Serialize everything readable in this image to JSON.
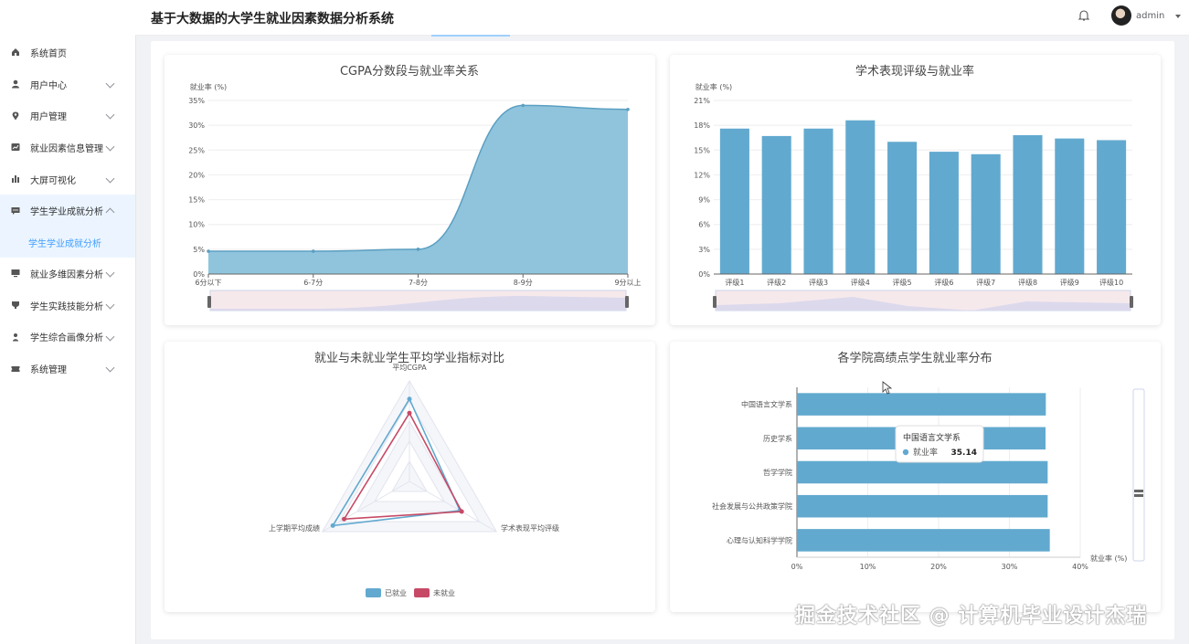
{
  "app": {
    "title": "基于大数据的大学生就业因素数据分析系统",
    "user": "admin"
  },
  "sidebar": {
    "items": [
      {
        "label": "系统首页",
        "icon": "home-icon",
        "arrow": false
      },
      {
        "label": "用户中心",
        "icon": "user-icon",
        "arrow": true
      },
      {
        "label": "用户管理",
        "icon": "location-icon",
        "arrow": true
      },
      {
        "label": "就业因素信息管理",
        "icon": "chart-icon",
        "arrow": true
      },
      {
        "label": "大屏可视化",
        "icon": "bar-icon",
        "arrow": true
      },
      {
        "label": "学生学业成就分析",
        "icon": "chat-icon",
        "arrow": true,
        "open": true
      },
      {
        "label": "就业多维因素分析",
        "icon": "monitor-icon",
        "arrow": true
      },
      {
        "label": "学生实践技能分析",
        "icon": "cup-icon",
        "arrow": true
      },
      {
        "label": "学生综合画像分析",
        "icon": "person-icon",
        "arrow": true
      },
      {
        "label": "系统管理",
        "icon": "ticket-icon",
        "arrow": true
      }
    ],
    "sub_active": "学生学业成就分析"
  },
  "watermark": "掘金技术社区 @ 计算机毕业设计杰瑞",
  "chart_data": [
    {
      "type": "area",
      "title": "CGPA分数段与就业率关系",
      "ylabel": "就业率 (%)",
      "categories": [
        "6分以下",
        "6-7分",
        "7-8分",
        "8-9分",
        "9分以上"
      ],
      "values": [
        4.6,
        4.6,
        5.0,
        34.0,
        33.2
      ],
      "ylim": [
        0,
        35
      ],
      "yticks": [
        "0%",
        "5%",
        "10%",
        "15%",
        "20%",
        "25%",
        "30%",
        "35%"
      ],
      "color": "#8fc4dc"
    },
    {
      "type": "bar",
      "title": "学术表现评级与就业率",
      "ylabel": "就业率 (%)",
      "categories": [
        "评级1",
        "评级2",
        "评级3",
        "评级4",
        "评级5",
        "评级6",
        "评级7",
        "评级8",
        "评级9",
        "评级10"
      ],
      "values": [
        17.6,
        16.7,
        17.6,
        18.6,
        16.0,
        14.8,
        14.5,
        16.8,
        16.4,
        16.2
      ],
      "ylim": [
        0,
        21
      ],
      "yticks": [
        "0%",
        "3%",
        "6%",
        "9%",
        "12%",
        "15%",
        "18%",
        "21%"
      ],
      "color": "#62a9cf"
    },
    {
      "type": "radar",
      "title": "就业与未就业学生平均学业指标对比",
      "indicators": [
        "平均CGPA",
        "上学期平均成绩",
        "学术表现平均评级"
      ],
      "series": [
        {
          "name": "已就业",
          "values": [
            0.82,
            0.88,
            0.58
          ],
          "color": "#62a9cf"
        },
        {
          "name": "未就业",
          "values": [
            0.68,
            0.75,
            0.6
          ],
          "color": "#c64a66"
        }
      ]
    },
    {
      "type": "bar",
      "orientation": "horizontal",
      "title": "各学院高绩点学生就业率分布",
      "xlabel": "就业率 (%)",
      "categories": [
        "中国语言文学系",
        "历史学系",
        "哲学学院",
        "社会发展与公共政策学院",
        "心理与认知科学学院"
      ],
      "values": [
        35.14,
        35.1,
        35.4,
        35.4,
        35.7
      ],
      "xlim": [
        0,
        40
      ],
      "xticks": [
        "0%",
        "10%",
        "20%",
        "30%",
        "40%"
      ],
      "color": "#62a9cf",
      "tooltip": {
        "title": "中国语言文学系",
        "label": "就业率",
        "value": "35.14"
      }
    }
  ]
}
